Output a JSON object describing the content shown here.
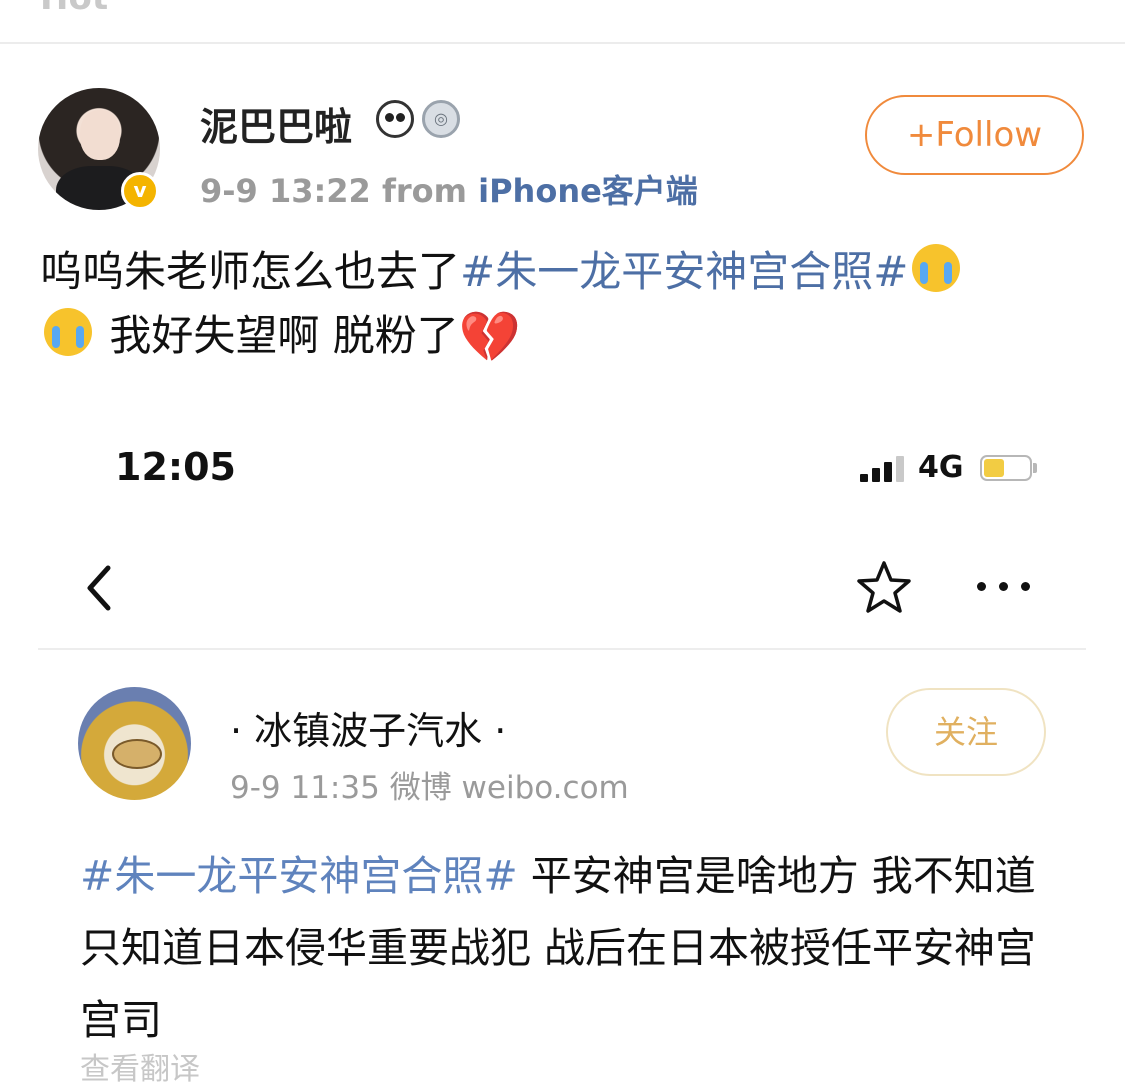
{
  "top": {
    "partial_label": "Hot"
  },
  "post": {
    "username": "泥巴巴啦",
    "verify_mark": "v",
    "badges": [
      "panda-icon",
      "medal-icon"
    ],
    "time": "9-9 13:22",
    "from_prefix": "from",
    "source": "iPhone客户端",
    "follow_label": "+Follow",
    "text": {
      "part1": "呜呜朱老师怎么也去了",
      "hashtag": "#朱一龙平安神宫合照#",
      "part2": " 我好失望啊 脱粉了"
    },
    "emojis": [
      "crying-emoji",
      "crying-emoji",
      "broken-heart-emoji"
    ]
  },
  "screenshot": {
    "status_bar": {
      "time": "12:05",
      "network": "4G",
      "battery_level": 0.45
    },
    "nav": {
      "back_icon": "chevron-left",
      "star_icon": "star-outline",
      "more_icon": "ellipsis"
    },
    "inner_post": {
      "username": "· 冰镇波子汽水 ·",
      "time": "9-9 11:35",
      "source": "微博 weibo.com",
      "follow_label": "关注",
      "hashtag": "#朱一龙平安神宫合照#",
      "text": " 平安神宫是啥地方 我不知道 只知道日本侵华重要战犯 战后在日本被授任平安神宫宫司",
      "translate_label": "查看翻译"
    }
  },
  "colors": {
    "link": "#4d6fa5",
    "follow": "#f08a3c",
    "inner_follow": "#e0b060",
    "meta": "#9a9a9a"
  }
}
